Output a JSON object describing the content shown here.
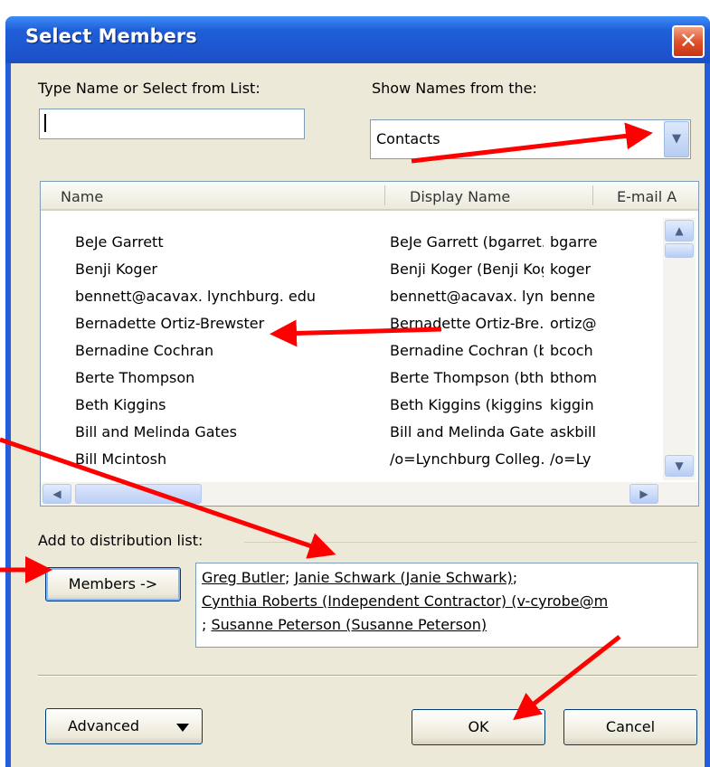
{
  "dialog": {
    "title": "Select Members",
    "close": "✕"
  },
  "search": {
    "label": "Type Name or Select from List:",
    "value": ""
  },
  "address_book": {
    "label": "Show Names from the:",
    "selected": "Contacts"
  },
  "list": {
    "columns": [
      "Name",
      "Display Name",
      "E-mail A"
    ],
    "rows": [
      {
        "name": "BeJe Garrett",
        "display": "BeJe Garrett (bgarret…",
        "email": "bgarre"
      },
      {
        "name": "Benji Koger",
        "display": "Benji Koger (Benji Kog…",
        "email": "koger"
      },
      {
        "name": "bennett@acavax. lynchburg. edu",
        "display": "bennett@acavax. lyn…",
        "email": "benne"
      },
      {
        "name": "Bernadette Ortiz-Brewster",
        "display": "Bernadette Ortiz-Bre…",
        "email": "ortiz@"
      },
      {
        "name": "Bernadine Cochran",
        "display": "Bernadine Cochran (b…",
        "email": "bcoch"
      },
      {
        "name": "Berte Thompson",
        "display": "Berte Thompson (bth…",
        "email": "bthom"
      },
      {
        "name": "Beth Kiggins",
        "display": "Beth Kiggins (kiggins…",
        "email": "kiggin"
      },
      {
        "name": "Bill and Melinda Gates",
        "display": "Bill and Melinda Gates…",
        "email": "askbill"
      },
      {
        "name": "Bill Mcintosh",
        "display": "/o=Lynchburg Colleg…",
        "email": "/o=Ly"
      }
    ]
  },
  "distribution": {
    "label": "Add to distribution list:",
    "members_button": "Members ->",
    "line1": [
      "Greg Butler",
      "Janie Schwark (Janie Schwark)"
    ],
    "line2": "Cynthia Roberts (Independent Contractor) (v-cyrobe@m",
    "line3": "Susanne Peterson (Susanne Peterson)"
  },
  "buttons": {
    "advanced": "Advanced",
    "ok": "OK",
    "cancel": "Cancel"
  },
  "colors": {
    "titlebar": "#245edb",
    "face": "#ece9d8",
    "annotation_arrow": "#ff0000"
  }
}
